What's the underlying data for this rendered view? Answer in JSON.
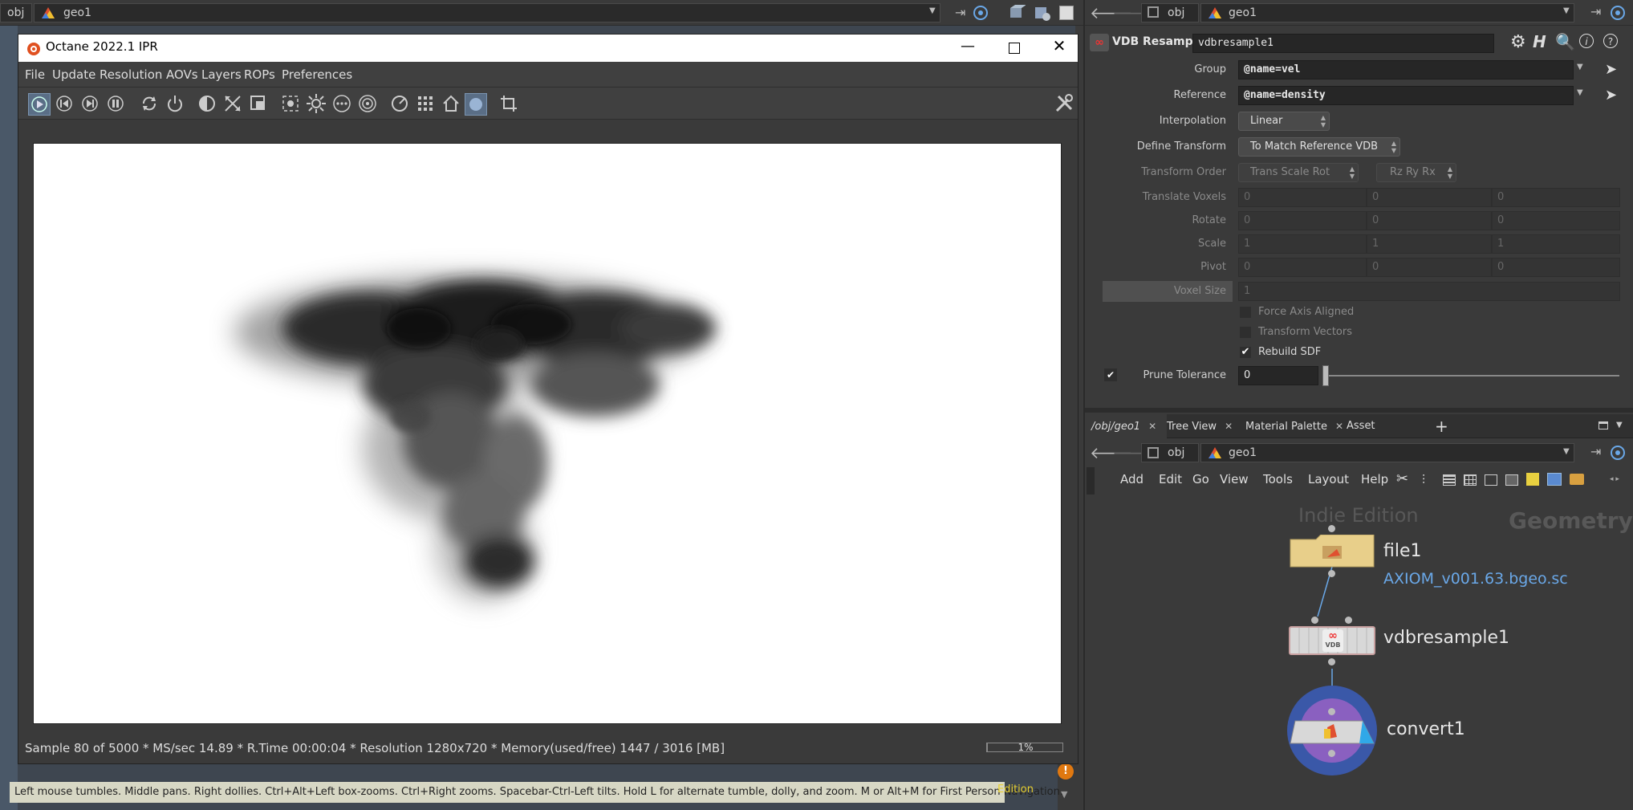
{
  "left_path": {
    "root": "obj",
    "node": "geo1"
  },
  "right_path": {
    "root": "obj",
    "node": "geo1"
  },
  "octane": {
    "title": "Octane 2022.1 IPR",
    "menu": [
      "File",
      "Update",
      "Resolution",
      "AOVs",
      "Layers",
      "ROPs",
      "Preferences"
    ],
    "status": "Sample 80 of 5000 * MS/sec 14.89 * R.Time 00:00:04 * Resolution 1280x720 * Memory(used/free) 1447 / 3016 [MB]",
    "progress_text": "1%",
    "progress_value": 0.01
  },
  "hint": {
    "text": "Left mouse tumbles. Middle pans. Right dollies. Ctrl+Alt+Left box-zooms. Ctrl+Right zooms. Spacebar-Ctrl-Left tilts. Hold L for alternate tumble, dolly, and zoom.     M or Alt+M for First Person Navigation.",
    "edition_fragment": "Edition"
  },
  "params": {
    "op_type": "VDB Resample",
    "node_name": "vdbresample1",
    "group_label": "Group",
    "group_value": "@name=vel",
    "reference_label": "Reference",
    "reference_value": "@name=density",
    "interpolation_label": "Interpolation",
    "interpolation_value": "Linear",
    "define_transform_label": "Define Transform",
    "define_transform_value": "To Match Reference VDB",
    "transform_order_label": "Transform Order",
    "transform_order_value": "Trans Scale Rot",
    "rotation_order_value": "Rz Ry Rx",
    "translate_voxels_label": "Translate Voxels",
    "translate_voxels": [
      "0",
      "0",
      "0"
    ],
    "rotate_label": "Rotate",
    "rotate": [
      "0",
      "0",
      "0"
    ],
    "scale_label": "Scale",
    "scale": [
      "1",
      "1",
      "1"
    ],
    "pivot_label": "Pivot",
    "pivot": [
      "0",
      "0",
      "0"
    ],
    "voxel_size_label": "Voxel Size",
    "voxel_size": "1",
    "force_axis_aligned_label": "Force Axis Aligned",
    "transform_vectors_label": "Transform Vectors",
    "rebuild_sdf_label": "Rebuild SDF",
    "rebuild_sdf_checked": true,
    "prune_tolerance_label": "Prune Tolerance",
    "prune_tolerance_value": "0",
    "prune_tolerance_slider": 0.0
  },
  "network": {
    "tabs": [
      "/obj/geo1",
      "Tree View",
      "Material Palette",
      "Asset Browser"
    ],
    "menu": [
      "Add",
      "Edit",
      "Go",
      "View",
      "Tools",
      "Layout",
      "Help"
    ],
    "watermark": "Indie Edition",
    "context_label": "Geometry",
    "nodes": [
      {
        "name": "file1",
        "subtitle": "AXIOM_v001.63.bgeo.sc"
      },
      {
        "name": "vdbresample1",
        "subtitle": ""
      },
      {
        "name": "convert1",
        "subtitle": ""
      }
    ]
  },
  "colors": {
    "accent_blue": "#6aa8e8",
    "selection": "#ffb000",
    "file_node": "#e8cf8a",
    "convert_ring": "#3a58a8"
  }
}
